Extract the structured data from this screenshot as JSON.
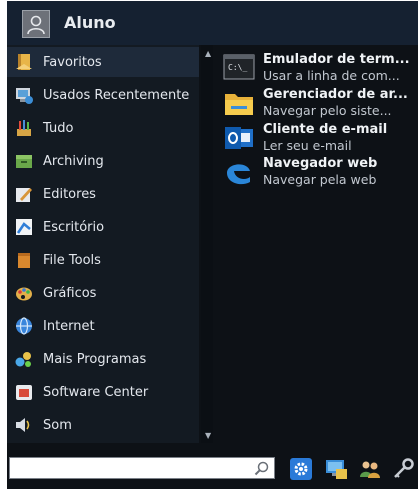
{
  "header": {
    "username": "Aluno"
  },
  "categories": [
    {
      "label": "Favoritos",
      "icon": "favorites-icon"
    },
    {
      "label": "Usados Recentemente",
      "icon": "recent-icon"
    },
    {
      "label": "Tudo",
      "icon": "all-apps-icon"
    },
    {
      "label": "Archiving",
      "icon": "archive-icon"
    },
    {
      "label": "Editores",
      "icon": "editors-icon"
    },
    {
      "label": "Escritório",
      "icon": "office-icon"
    },
    {
      "label": "File Tools",
      "icon": "file-tools-icon"
    },
    {
      "label": "Gráficos",
      "icon": "graphics-icon"
    },
    {
      "label": "Internet",
      "icon": "internet-icon"
    },
    {
      "label": "Mais Programas",
      "icon": "more-programs-icon"
    },
    {
      "label": "Software Center",
      "icon": "software-center-icon"
    },
    {
      "label": "Som",
      "icon": "sound-icon"
    }
  ],
  "apps": [
    {
      "name": "Emulador de term...",
      "desc": "Usar a linha de com...",
      "icon": "terminal-icon"
    },
    {
      "name": "Gerenciador de ar...",
      "desc": "Navegar pelo siste...",
      "icon": "folder-icon"
    },
    {
      "name": "Cliente de e-mail",
      "desc": "Ler seu e-mail",
      "icon": "outlook-icon"
    },
    {
      "name": "Navegador web",
      "desc": "Navegar pela web",
      "icon": "edge-browser-icon"
    }
  ],
  "search": {
    "value": "",
    "placeholder": ""
  },
  "toolbar": [
    "settings-icon",
    "display-icon",
    "users-icon",
    "key-icon"
  ],
  "colors": {
    "background": "#0d1116",
    "header": "#152131",
    "selected": "#1e2a3a",
    "text": "#e4e8ee"
  }
}
